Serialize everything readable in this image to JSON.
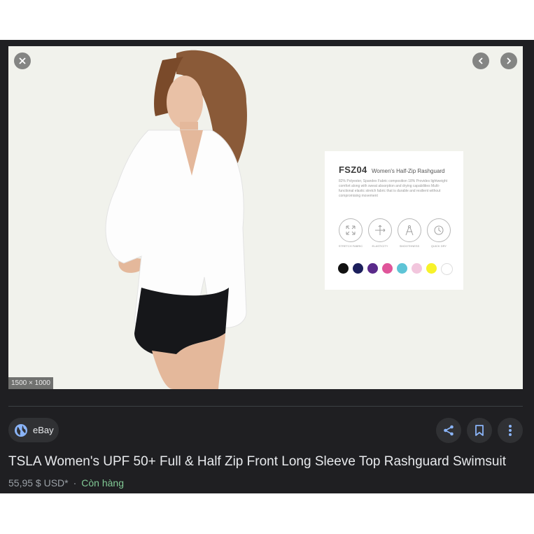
{
  "viewer": {
    "dimensions": "1500 × 1000",
    "card": {
      "code": "FSZ04",
      "name": "Women's Half-Zip Rashguard",
      "description": "82% Polyester, Spandex Fabric composition 18% Provides lightweight comfort along with sweat absorption and drying capabilities Multi-functional elastic stretch fabric that is durable and resilient without compromising movement",
      "features": [
        {
          "label": "STRETCH FABRIC",
          "icon": "stretch-icon"
        },
        {
          "label": "ELASTICITY",
          "icon": "elasticity-icon"
        },
        {
          "label": "SMOOTHNESS",
          "icon": "compass-icon"
        },
        {
          "label": "QUICK DRY",
          "icon": "quick-dry-icon"
        }
      ],
      "colors": [
        "#111111",
        "#1c1f5c",
        "#5a2a8a",
        "#e0559a",
        "#5ec4d6",
        "#f2c6dd",
        "#f7f22a",
        "#ffffff"
      ]
    }
  },
  "source": {
    "label": "eBay",
    "icon": "globe-icon"
  },
  "product": {
    "title": "TSLA Women's UPF 50+ Full & Half Zip Front Long Sleeve Top Rashguard Swimsuit",
    "price": "55,95 $ USD*",
    "separator": "·",
    "stock": "Còn hàng"
  },
  "colors": {
    "panel_bg": "#1f1f22",
    "chip_bg": "#303134",
    "title_text": "#e8eaed",
    "stock_green": "#81c995",
    "icon_blue": "#8ab4f8"
  }
}
